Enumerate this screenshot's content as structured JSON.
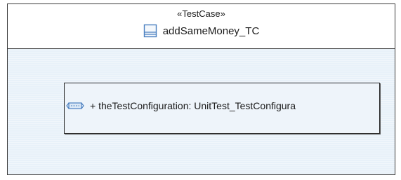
{
  "test_case": {
    "stereotype": "«TestCase»",
    "name": "addSameMoney_TC",
    "icon": "test-case-icon"
  },
  "part": {
    "label": "+ theTestConfiguration: UnitTest_TestConfigura",
    "icon": "part-property-icon"
  },
  "colors": {
    "border": "#3a3a3a",
    "compartment_fill": "#e8f1f9",
    "icon_blue": "#4a7fc0"
  }
}
